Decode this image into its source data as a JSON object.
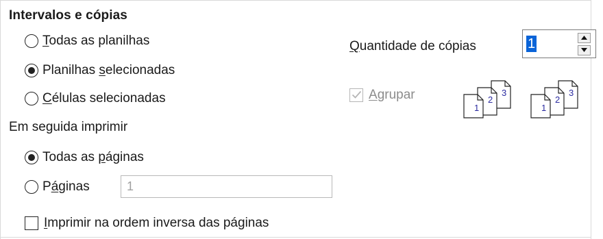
{
  "range_section": {
    "title": "Intervalos e cópias",
    "options": [
      {
        "first": "T",
        "rest": "odas as planilhas",
        "checked": false
      },
      {
        "pre": "Planilhas ",
        "key": "s",
        "post": "elecionadas",
        "checked": true
      },
      {
        "first": "C",
        "rest": "élulas selecionadas",
        "checked": false
      }
    ]
  },
  "print_section": {
    "title": "Em seguida imprimir",
    "all_pages": {
      "pre": "Todas as ",
      "key": "p",
      "post": "áginas",
      "checked": true
    },
    "pages": {
      "pre": "P",
      "key": "á",
      "post": "ginas",
      "checked": false,
      "value": "1"
    },
    "reverse": {
      "first": "I",
      "rest": "mprimir na ordem inversa das páginas",
      "checked": false
    }
  },
  "copies": {
    "label_first": "Q",
    "label_rest": "uantidade de cópias",
    "value": "1"
  },
  "collate": {
    "first": "A",
    "rest": "grupar",
    "checked": true,
    "disabled": true
  },
  "collate_icon_numbers": [
    "1",
    "2",
    "3"
  ],
  "colors": {
    "selection": "#0a64d8",
    "disabled_text": "#8c8c8c",
    "icon_number": "#2a2aa0"
  },
  "icons": {
    "up": "spin-up-icon",
    "down": "spin-down-icon",
    "collate_pages": "collate-pages-icon"
  }
}
